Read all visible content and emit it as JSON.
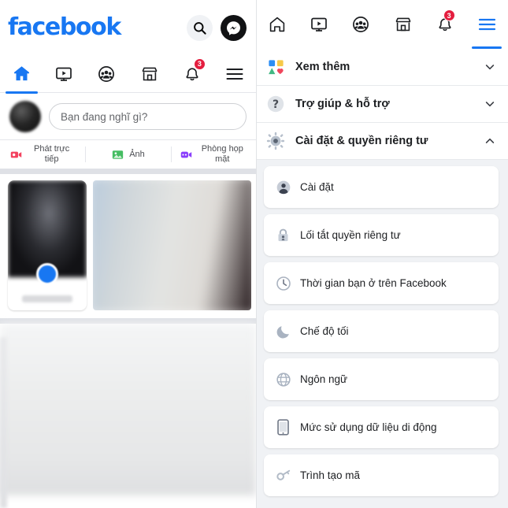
{
  "left_panel": {
    "brand": "facebook",
    "brand_color": "#1877f2",
    "actions": [
      {
        "name": "search-icon",
        "label": "Tìm kiếm"
      },
      {
        "name": "messenger-icon",
        "label": "Messenger"
      }
    ],
    "nav": [
      {
        "name": "home",
        "label": "Trang chủ",
        "active": true,
        "badge": null
      },
      {
        "name": "video",
        "label": "Video",
        "active": false,
        "badge": null
      },
      {
        "name": "friends",
        "label": "Bạn bè",
        "active": false,
        "badge": null
      },
      {
        "name": "marketplace",
        "label": "Marketplace",
        "active": false,
        "badge": null
      },
      {
        "name": "notifications",
        "label": "Thông báo",
        "active": false,
        "badge": "3"
      },
      {
        "name": "menu",
        "label": "Menu",
        "active": false,
        "badge": null
      }
    ],
    "composer": {
      "placeholder": "Bạn đang nghĩ gì?",
      "avatar_name": "user-avatar"
    },
    "composer_actions": [
      {
        "label": "Phát trực tiếp",
        "icon": "live-video-icon",
        "color": "#f3425f"
      },
      {
        "label": "Ảnh",
        "icon": "photo-icon",
        "color": "#45bd62"
      },
      {
        "label": "Phòng họp mặt",
        "icon": "room-video-icon",
        "color": "#8a3ffc"
      }
    ],
    "badge_color": "#e41e3f"
  },
  "right_panel": {
    "nav": [
      {
        "name": "home",
        "label": "Trang chủ",
        "active": false,
        "badge": null
      },
      {
        "name": "video",
        "label": "Video",
        "active": false,
        "badge": null
      },
      {
        "name": "friends",
        "label": "Bạn bè",
        "active": false,
        "badge": null
      },
      {
        "name": "marketplace",
        "label": "Marketplace",
        "active": false,
        "badge": null
      },
      {
        "name": "notifications",
        "label": "Thông báo",
        "active": false,
        "badge": "3"
      },
      {
        "name": "menu",
        "label": "Menu",
        "active": true,
        "badge": null
      }
    ],
    "sections": [
      {
        "label": "Xem thêm",
        "icon": "shortcuts-grid-icon",
        "expanded": false
      },
      {
        "label": "Trợ giúp & hỗ trợ",
        "icon": "question-mark-icon",
        "expanded": false
      },
      {
        "label": "Cài đặt & quyền riêng tư",
        "icon": "gear-icon",
        "expanded": true
      }
    ],
    "settings_items": [
      {
        "label": "Cài đặt",
        "icon": "profile-settings-icon"
      },
      {
        "label": "Lối tắt quyền riêng tư",
        "icon": "lock-icon"
      },
      {
        "label": "Thời gian bạn ở trên Facebook",
        "icon": "clock-icon"
      },
      {
        "label": "Chế độ tối",
        "icon": "moon-icon"
      },
      {
        "label": "Ngôn ngữ",
        "icon": "globe-icon"
      },
      {
        "label": "Mức sử dụng dữ liệu di động",
        "icon": "mobile-phone-icon"
      },
      {
        "label": "Trình tạo mã",
        "icon": "key-icon"
      }
    ],
    "accent_color": "#1877f2",
    "background_color": "#f0f2f5"
  }
}
